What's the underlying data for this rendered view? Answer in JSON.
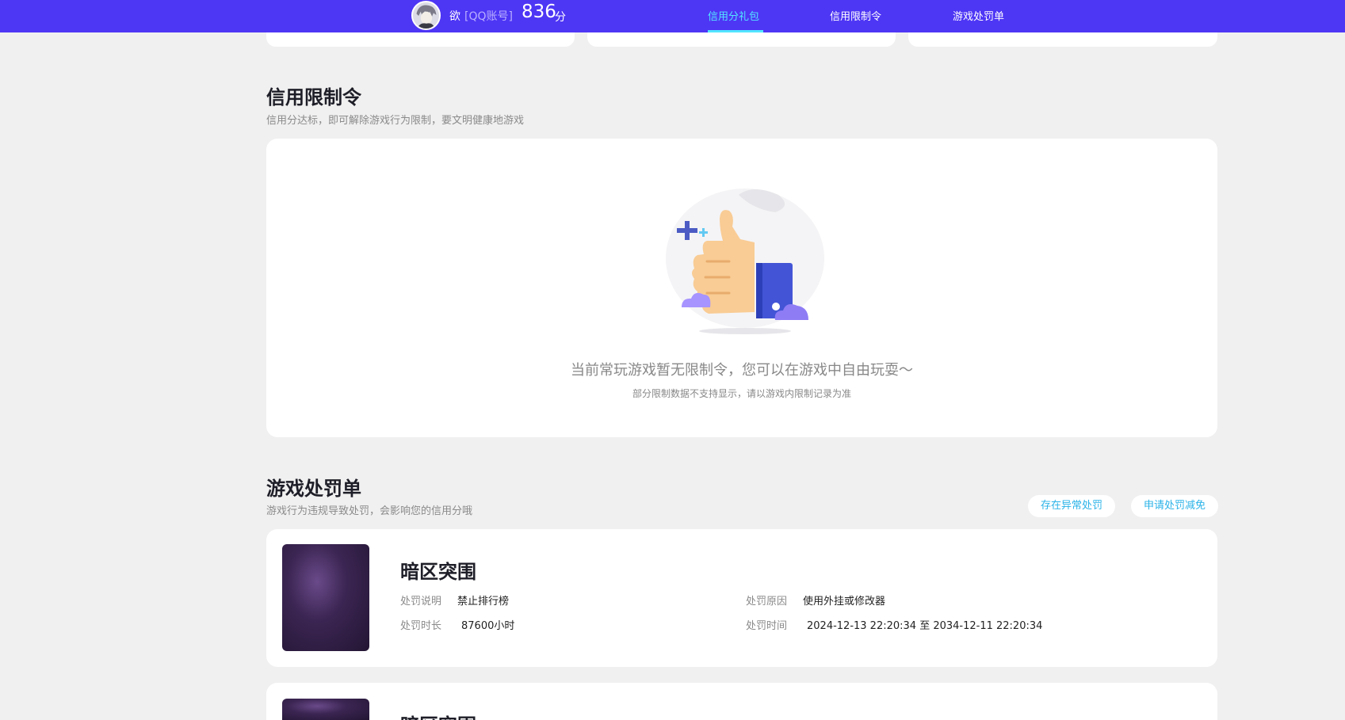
{
  "header": {
    "username": "欲",
    "account_type": "[QQ账号]",
    "score": "836",
    "score_unit": "分",
    "nav": [
      {
        "label": "信用分礼包",
        "active": true
      },
      {
        "label": "信用限制令",
        "active": false
      },
      {
        "label": "游戏处罚单",
        "active": false
      }
    ]
  },
  "restriction": {
    "title": "信用限制令",
    "subtitle": "信用分达标，即可解除游戏行为限制，要文明健康地游戏",
    "empty_message": "当前常玩游戏暂无限制令，您可以在游戏中自由玩耍～",
    "empty_note": "部分限制数据不支持显示，请以游戏内限制记录为准"
  },
  "penalty": {
    "title": "游戏处罚单",
    "subtitle": "游戏行为违规导致处罚，会影响您的信用分哦",
    "buttons": {
      "abnormal": "存在异常处罚",
      "appeal": "申请处罚减免"
    },
    "labels": {
      "desc": "处罚说明",
      "duration": "处罚时长",
      "reason": "处罚原因",
      "time": "处罚时间"
    },
    "items": [
      {
        "game": "暗区突围",
        "desc": "禁止排行榜",
        "duration": "87600小时",
        "reason": "使用外挂或修改器",
        "time": "2024-12-13 22:20:34 至 2034-12-11 22:20:34"
      },
      {
        "game": "暗区突围"
      }
    ]
  },
  "colors": {
    "header_bg": "#4e36f5",
    "accent": "#52e6ff",
    "link": "#2bb3e8"
  }
}
